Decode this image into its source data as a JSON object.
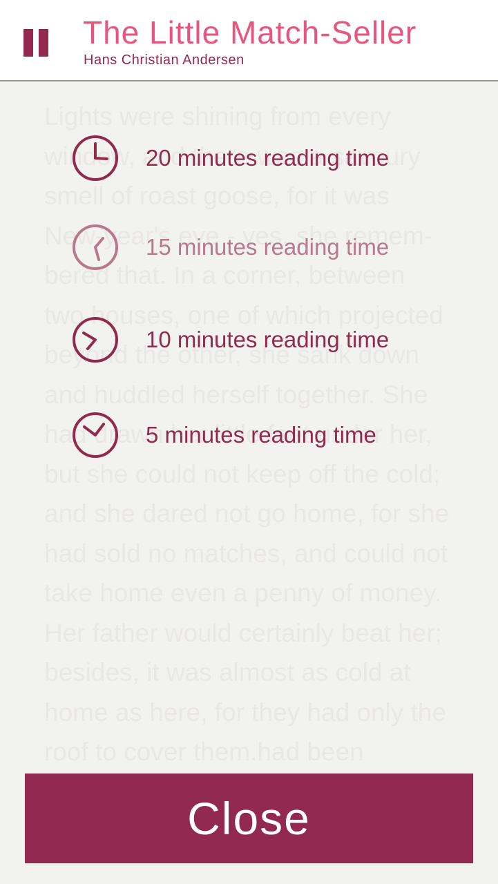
{
  "header": {
    "title": "The Little Match-Seller",
    "author": "Hans Christian Andersen",
    "pause_icon": "pause-icon"
  },
  "story_text": "Lights were shining from every\nwindow, and there was a savoury\nsmell of roast goose, for it was\nNew-year's eve - yes, she remem-\nbered that. In a corner, between\ntwo houses, one of which projected\nbeyond the other, she sank down\nand huddled herself together. She\nhad drawn her little feet under her,\nbut she could not keep off the cold;\nand she dared not go home, for she\nhad sold no matches, and could not\ntake home even a penny of money.\nHer father would certainly beat her;\nbesides, it was almost as cold at\nhome as here, for they had only the\nroof to cover them.had been",
  "reading_options": [
    {
      "label": "20 minutes reading time",
      "icon": "clock-20-icon",
      "selected": false
    },
    {
      "label": "15 minutes reading time",
      "icon": "clock-15-icon",
      "selected": true
    },
    {
      "label": "10 minutes reading time",
      "icon": "clock-10-icon",
      "selected": false
    },
    {
      "label": "5 minutes reading time",
      "icon": "clock-5-icon",
      "selected": false
    }
  ],
  "close_label": "Close",
  "colors": {
    "accent": "#922a50",
    "title_pink": "#e5577f",
    "faded": "#b8788f",
    "background": "#f2f2f1"
  }
}
